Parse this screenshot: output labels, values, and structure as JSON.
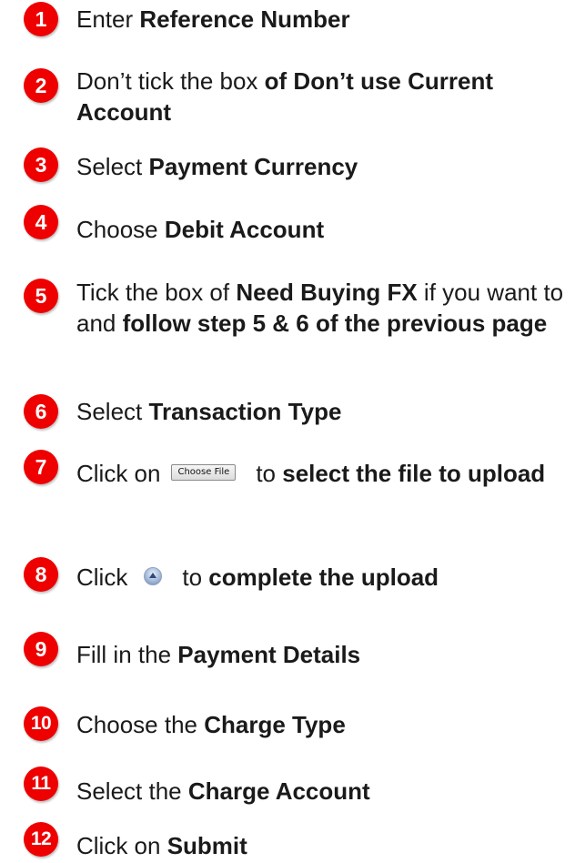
{
  "accent_color": "#ee0000",
  "steps": [
    {
      "num": "1",
      "parts": [
        [
          "Enter ",
          false
        ],
        [
          "Reference Number",
          true
        ]
      ]
    },
    {
      "num": "2",
      "parts": [
        [
          "Don’t tick the box ",
          false
        ],
        [
          "of Don’t use Current Account",
          true
        ]
      ]
    },
    {
      "num": "3",
      "parts": [
        [
          "Select ",
          false
        ],
        [
          "Payment Currency",
          true
        ]
      ]
    },
    {
      "num": "4",
      "parts": [
        [
          "Choose ",
          false
        ],
        [
          "Debit Account",
          true
        ]
      ]
    },
    {
      "num": "5",
      "parts": [
        [
          "Tick the box of ",
          false
        ],
        [
          "Need Buying FX",
          true
        ],
        [
          " if you want to and ",
          false
        ],
        [
          "follow step 5 & 6 of the previous page",
          true
        ]
      ]
    },
    {
      "num": "6",
      "parts": [
        [
          "Select ",
          false
        ],
        [
          "Transaction Type",
          true
        ]
      ]
    },
    {
      "num": "7",
      "before": "Click on",
      "button_label": "Choose File",
      "after": "to ",
      "after_bold": "select the file to upload"
    },
    {
      "num": "8",
      "before": "Click",
      "icon": "upload-arrow-icon",
      "after": "to ",
      "after_bold": "complete the upload"
    },
    {
      "num": "9",
      "parts": [
        [
          "Fill in the ",
          false
        ],
        [
          "Payment Details",
          true
        ]
      ]
    },
    {
      "num": "10",
      "parts": [
        [
          "Choose the ",
          false
        ],
        [
          "Charge Type",
          true
        ]
      ]
    },
    {
      "num": "11",
      "parts": [
        [
          "Select the ",
          false
        ],
        [
          "Charge Account",
          true
        ]
      ]
    },
    {
      "num": "12",
      "parts": [
        [
          "Click on ",
          false
        ],
        [
          "Submit",
          true
        ]
      ]
    }
  ]
}
